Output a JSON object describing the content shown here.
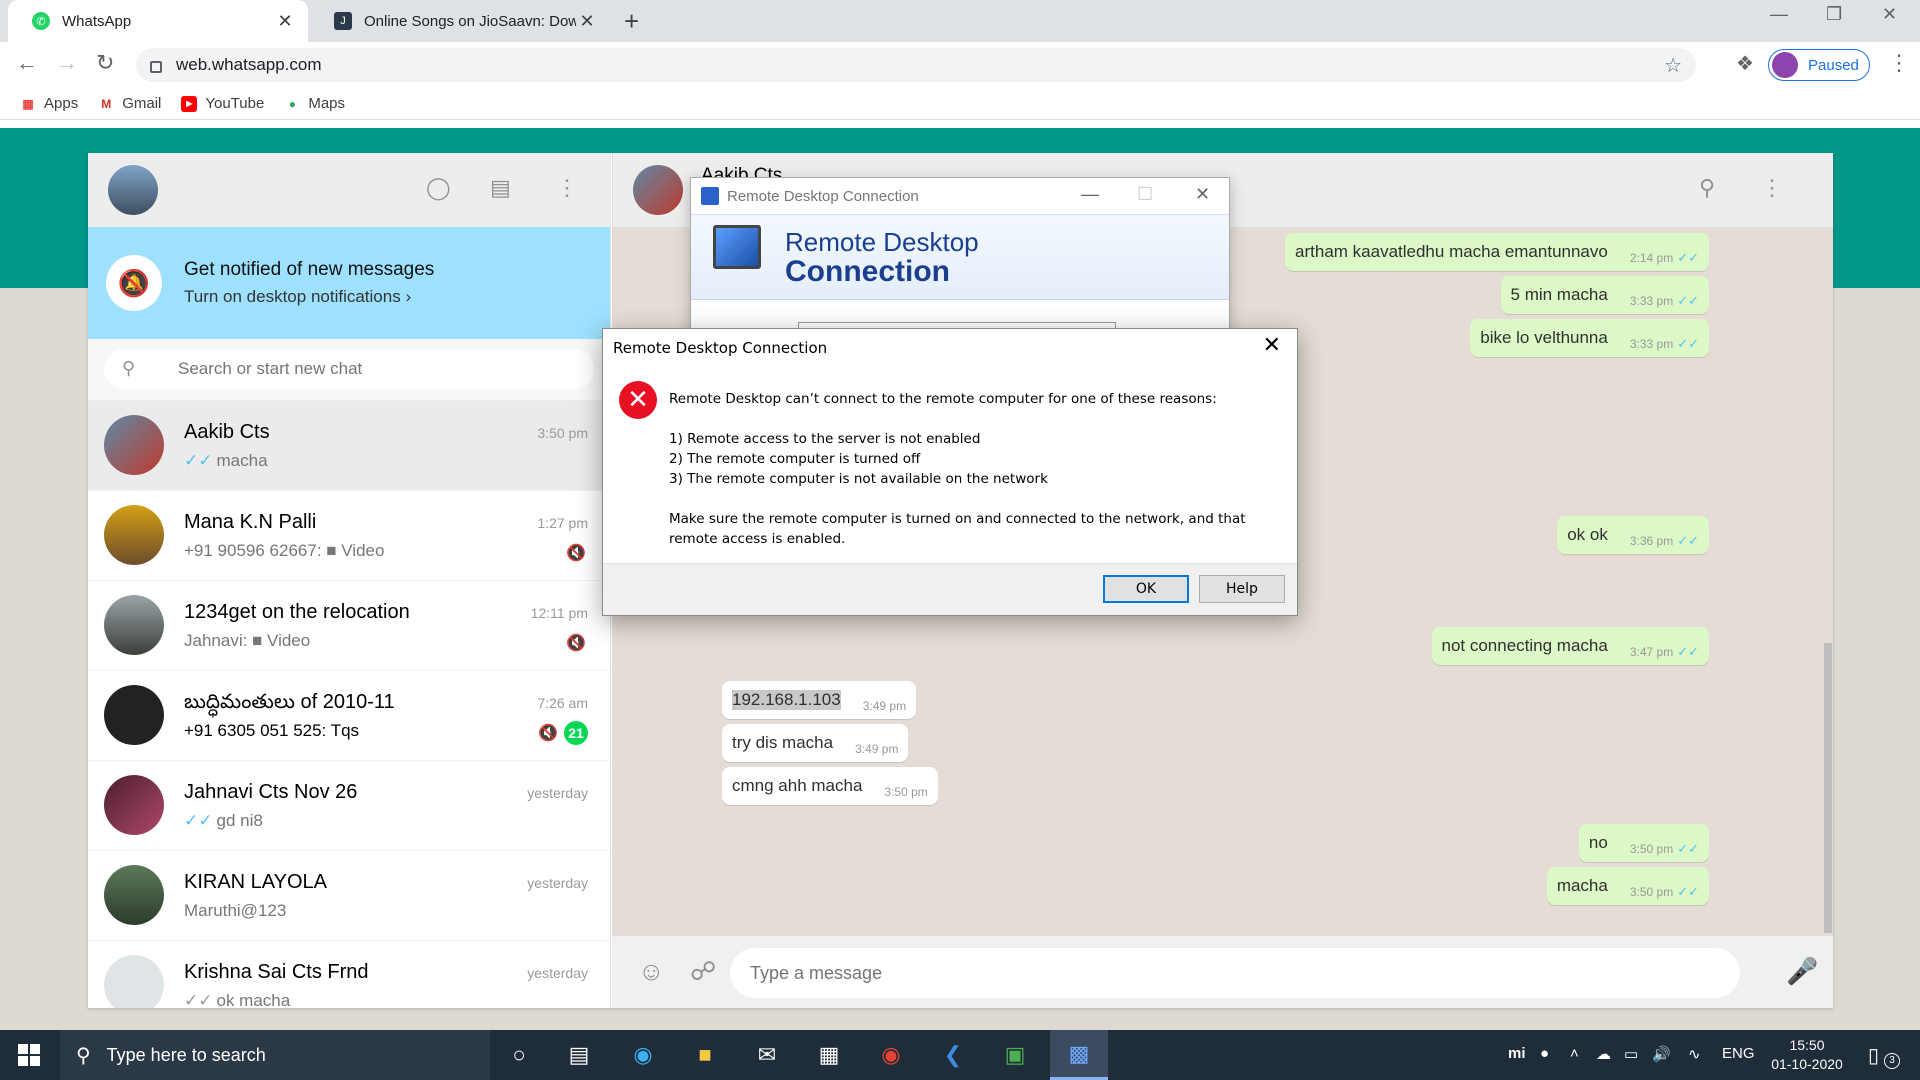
{
  "browser": {
    "tabs": [
      {
        "title": "WhatsApp",
        "active": true
      },
      {
        "title": "Online Songs on JioSaavn: Down",
        "active": false
      }
    ],
    "url": "web.whatsapp.com",
    "profile_label": "Paused",
    "bookmarks": [
      "Apps",
      "Gmail",
      "YouTube",
      "Maps"
    ]
  },
  "whatsapp": {
    "notification": {
      "title": "Get notified of new messages",
      "subtitle": "Turn on desktop notifications ›"
    },
    "search_placeholder": "Search or start new chat",
    "chats": [
      {
        "name": "Aakib Cts",
        "time": "3:50 pm",
        "preview": "macha",
        "ticks": true,
        "muted": false,
        "badge": "",
        "selected": true
      },
      {
        "name": "Mana K.N Palli",
        "time": "1:27 pm",
        "preview": "+91 90596 62667: ■ Video",
        "ticks": false,
        "muted": true,
        "badge": "",
        "selected": false
      },
      {
        "name": "1234get on the relocation",
        "time": "12:11 pm",
        "preview": "Jahnavi: ■ Video",
        "ticks": false,
        "muted": true,
        "badge": "",
        "selected": false
      },
      {
        "name": "బుద్ధిమంతులు of 2010-11",
        "time": "7:26 am",
        "preview": "+91 6305 051 525: Tqs",
        "ticks": false,
        "muted": true,
        "badge": "21",
        "selected": false
      },
      {
        "name": "Jahnavi Cts Nov 26",
        "time": "yesterday",
        "preview": "gd ni8",
        "ticks": true,
        "muted": false,
        "badge": "",
        "selected": false
      },
      {
        "name": "KIRAN LAYOLA",
        "time": "yesterday",
        "preview": "Maruthi@123",
        "ticks": false,
        "muted": false,
        "badge": "",
        "selected": false
      },
      {
        "name": "Krishna Sai Cts Frnd",
        "time": "yesterday",
        "preview": "ok macha",
        "ticks": true,
        "muted": false,
        "badge": "",
        "selected": false
      }
    ],
    "conversation": {
      "contact_name": "Aakib Cts",
      "messages": [
        {
          "dir": "out",
          "text": "artham kaavatledhu macha emantunnavo",
          "time": "2:14 pm"
        },
        {
          "dir": "out",
          "text": "5 min macha",
          "time": "3:33 pm"
        },
        {
          "dir": "out",
          "text": "bike lo velthunna",
          "time": "3:33 pm"
        },
        {
          "dir": "out",
          "text": "ok ok",
          "time": "3:36 pm"
        },
        {
          "dir": "out",
          "text": "not connecting macha",
          "time": "3:47 pm"
        },
        {
          "dir": "in",
          "text": "192.168.1.103",
          "time": "3:49 pm"
        },
        {
          "dir": "in",
          "text": "try dis macha",
          "time": "3:49 pm"
        },
        {
          "dir": "in",
          "text": "cmng ahh macha",
          "time": "3:50 pm"
        },
        {
          "dir": "out",
          "text": "no",
          "time": "3:50 pm"
        },
        {
          "dir": "out",
          "text": "macha",
          "time": "3:50 pm"
        }
      ],
      "compose_placeholder": "Type a message"
    }
  },
  "rdc_window": {
    "title": "Remote Desktop Connection",
    "banner_line1": "Remote Desktop",
    "banner_line2": "Connection"
  },
  "error_dialog": {
    "title": "Remote Desktop Connection",
    "intro": "Remote Desktop can’t connect to the remote computer for one of these reasons:",
    "reasons": [
      "1) Remote access to the server is not enabled",
      "2) The remote computer is turned off",
      "3) The remote computer is not available on the network"
    ],
    "advice": "Make sure the remote computer is turned on and connected to the network, and that remote access is enabled.",
    "ok_label": "OK",
    "help_label": "Help"
  },
  "taskbar": {
    "search_placeholder": "Type here to search",
    "language": "ENG",
    "time": "15:50",
    "date": "01-10-2020",
    "notification_count": "3"
  }
}
